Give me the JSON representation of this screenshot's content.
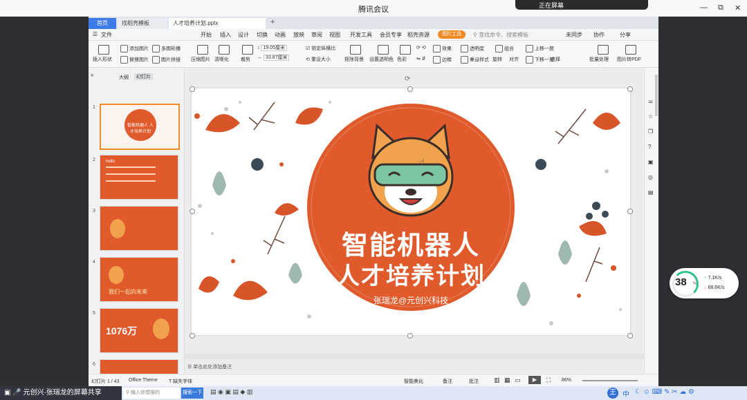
{
  "meeting": {
    "title": "腾讯会议",
    "notification": "正在屏幕"
  },
  "window_controls": [
    "—",
    "⧉",
    "✕"
  ],
  "wps": {
    "tabs": {
      "home": "首页",
      "template": "找稻壳模板",
      "doc": "人才培养计划.pptx"
    },
    "menu": [
      "文件",
      "开始",
      "插入",
      "设计",
      "切换",
      "动画",
      "放映",
      "审阅",
      "视图",
      "开发工具",
      "会员专享",
      "稻壳资源"
    ],
    "special_tools": "图片工具",
    "search_placeholder": "查找命令、搜索模板",
    "right_menu": [
      "未同步",
      "协作",
      "分享"
    ],
    "ribbon": {
      "insert_shape": "插入形状",
      "add_image": "添加图片",
      "multi_image": "多图轮播",
      "replace_image": "替换图片",
      "image_stitch": "图片拼接",
      "compress": "压缩图片",
      "sharpen": "清晰化",
      "crop": "裁剪",
      "height": "19.05厘米",
      "width": "33.87厘米",
      "lock_ratio": "锁定纵横比",
      "reset_size": "重设大小",
      "remove_bg": "抠除背景",
      "set_transparent": "设置透明色",
      "color": "色彩",
      "effect": "效果",
      "border": "边框",
      "transparency": "透明度",
      "reset_style": "重设样式",
      "combine": "组合",
      "rotate": "旋转",
      "align": "对齐",
      "up_layer": "上移一层",
      "down_layer": "下移一层",
      "select": "选择",
      "batch": "批量处理",
      "to_pdf": "图片转PDF"
    },
    "panel_tabs": {
      "outline": "大纲",
      "slides": "幻灯片"
    },
    "slide": {
      "title_line1": "智能机器人",
      "title_line2": "人才培养计划",
      "author": "张瑞龙@元创兴科技",
      "notes_placeholder": "单击此处添加备注"
    },
    "thumbs": [
      {
        "num": "1",
        "text": "智能机器人 人才培养计划"
      },
      {
        "num": "2",
        "text": "hello"
      },
      {
        "num": "3",
        "text": ""
      },
      {
        "num": "4",
        "text": "我们一起向未来"
      },
      {
        "num": "5",
        "text": "1076万"
      },
      {
        "num": "6",
        "text": ""
      }
    ],
    "status": {
      "slide_count": "幻灯片 1 / 43",
      "theme": "Office Theme",
      "missing_font": "缺失字体",
      "smart_beautify": "智能美化",
      "notes": "备注",
      "comments": "批注",
      "zoom": "86%"
    }
  },
  "cpu": {
    "percent": "38",
    "unit": "%",
    "up": "7.1K/s",
    "down": "68.6K/s",
    "ring_color": "#33c28a"
  },
  "taskbar": {
    "share_label": "元创兴·张瑞龙的屏幕共享",
    "search": "输入你想搜的",
    "start": "搜索一下",
    "tray_lang": "中"
  },
  "colors": {
    "accent_orange": "#e05a2b",
    "wps_blue": "#3d7ce8",
    "tool_orange": "#f08a24"
  }
}
